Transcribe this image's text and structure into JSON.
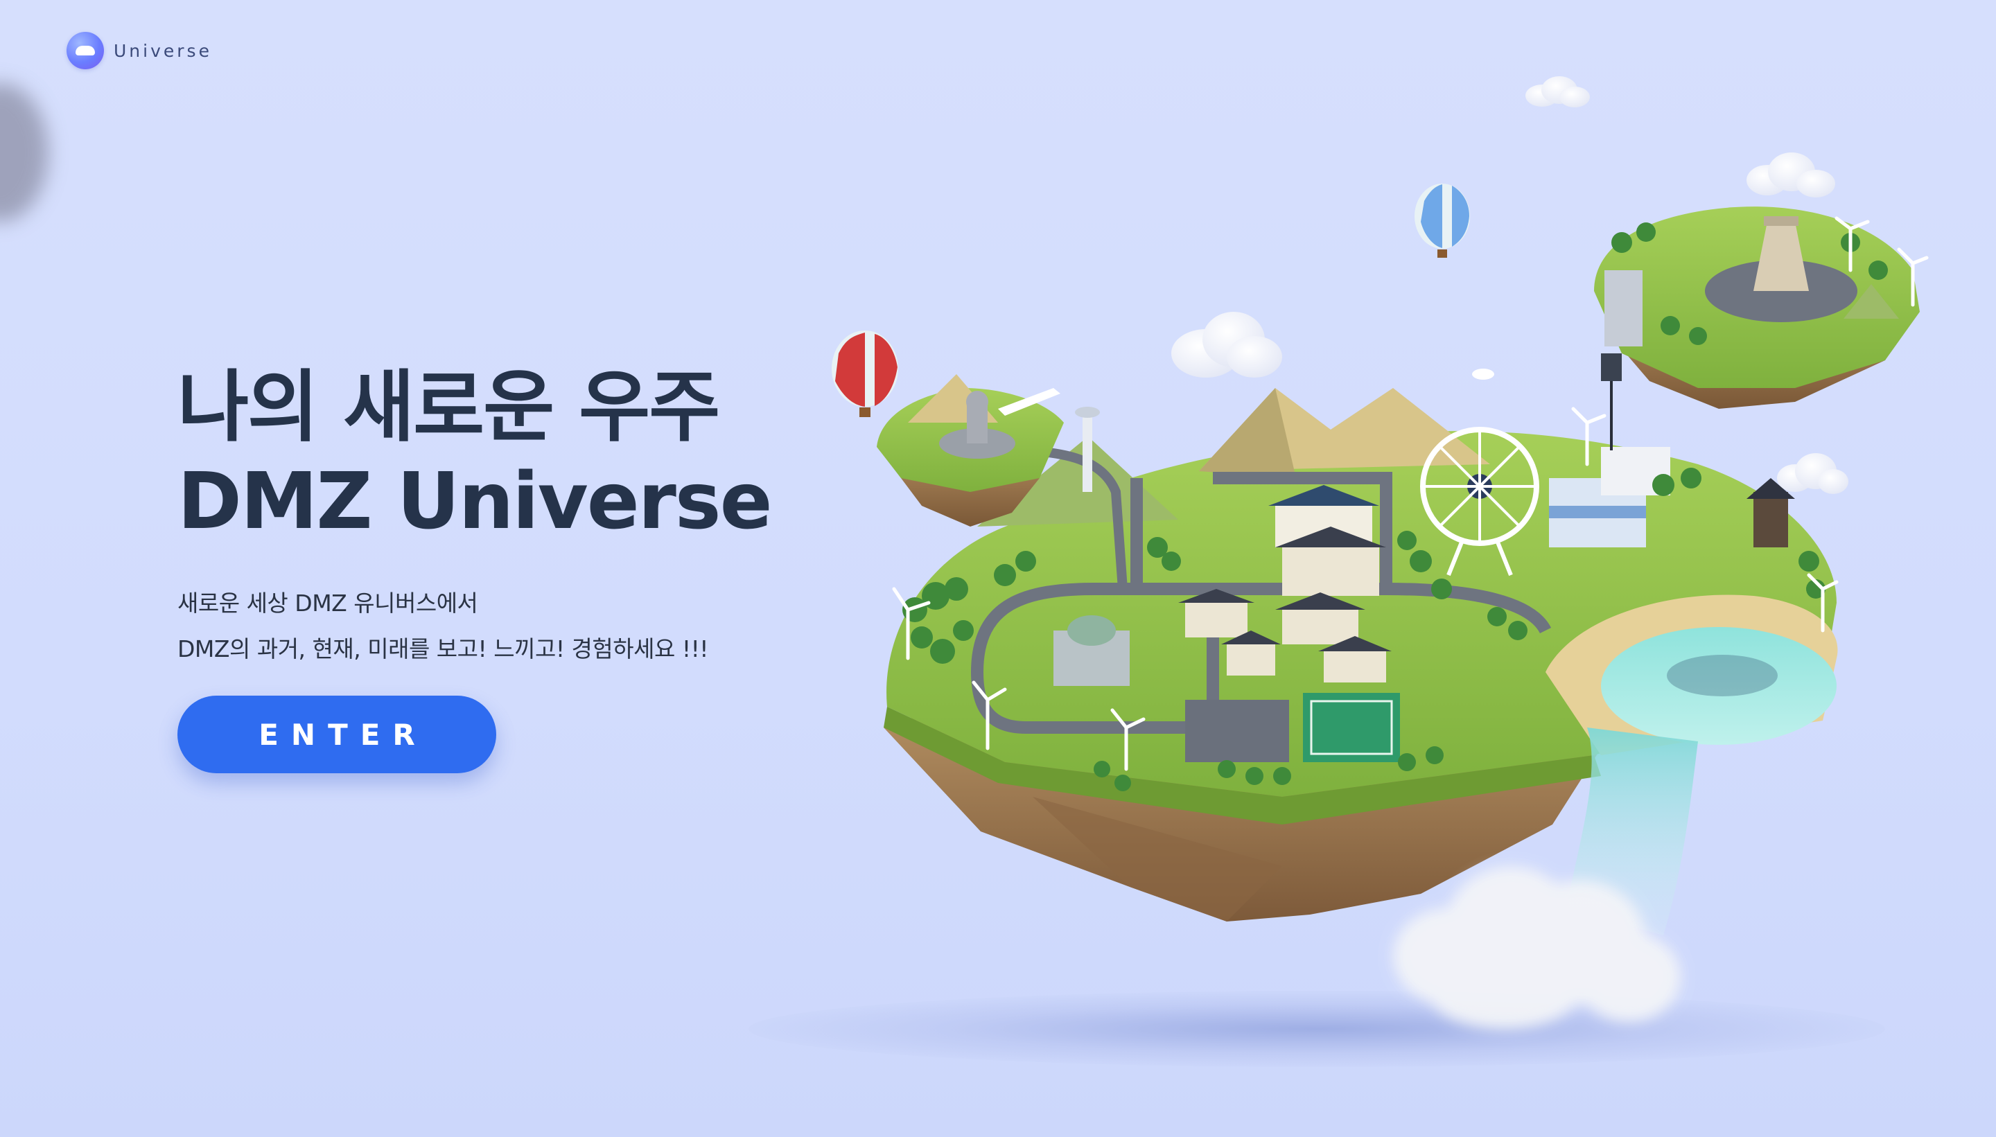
{
  "header": {
    "logo_text": "Universe"
  },
  "hero": {
    "title_line1": "나의 새로운 우주",
    "title_line2": "DMZ Universe",
    "subtitle_line1": "새로운 세상 DMZ 유니버스에서",
    "subtitle_line2": "DMZ의 과거, 현재, 미래를 보고! 느끼고! 경험하세요 !!!",
    "enter_label": "ENTER"
  },
  "colors": {
    "background": "#d4deff",
    "title": "#25334a",
    "button": "#2f6cf0",
    "button_text": "#ffffff"
  }
}
